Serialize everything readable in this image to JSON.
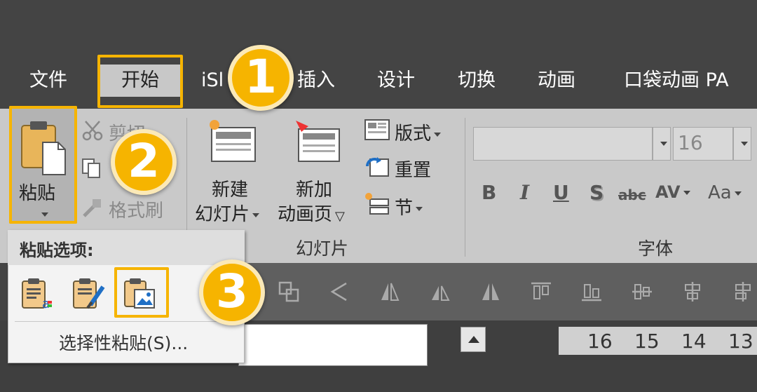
{
  "tabs": [
    {
      "label": "文件"
    },
    {
      "label": "开始"
    },
    {
      "label": "iSl"
    },
    {
      "label": "插入"
    },
    {
      "label": "设计"
    },
    {
      "label": "切换"
    },
    {
      "label": "动画"
    },
    {
      "label": "口袋动画 PA"
    }
  ],
  "clipboard": {
    "paste_label": "粘贴",
    "cut_label": "剪切",
    "format_painter_label": "格式刷"
  },
  "slides": {
    "new_slide_line1": "新建",
    "new_slide_line2": "幻灯片",
    "new_anim_line1": "新加",
    "new_anim_line2": "动画页",
    "layout_label": "版式",
    "reset_label": "重置",
    "section_label": "节",
    "group_label": "幻灯片"
  },
  "font": {
    "font_name_value": "",
    "font_size_value": "16",
    "bold": "B",
    "italic": "I",
    "underline": "U",
    "shadow": "S",
    "strikethrough": "abc",
    "spacing": "AV",
    "case": "Aa",
    "group_label": "字体"
  },
  "paste_menu": {
    "title": "粘贴选项:",
    "special_paste": "选择性粘贴(S)..."
  },
  "ruler": {
    "numbers": [
      "16",
      "15",
      "14",
      "13"
    ]
  },
  "badges": {
    "step1": "1",
    "step2": "2",
    "step3": "3"
  },
  "colors": {
    "highlight": "#f6b400",
    "tab_bar": "#444444",
    "ribbon": "#c9c9c9"
  }
}
